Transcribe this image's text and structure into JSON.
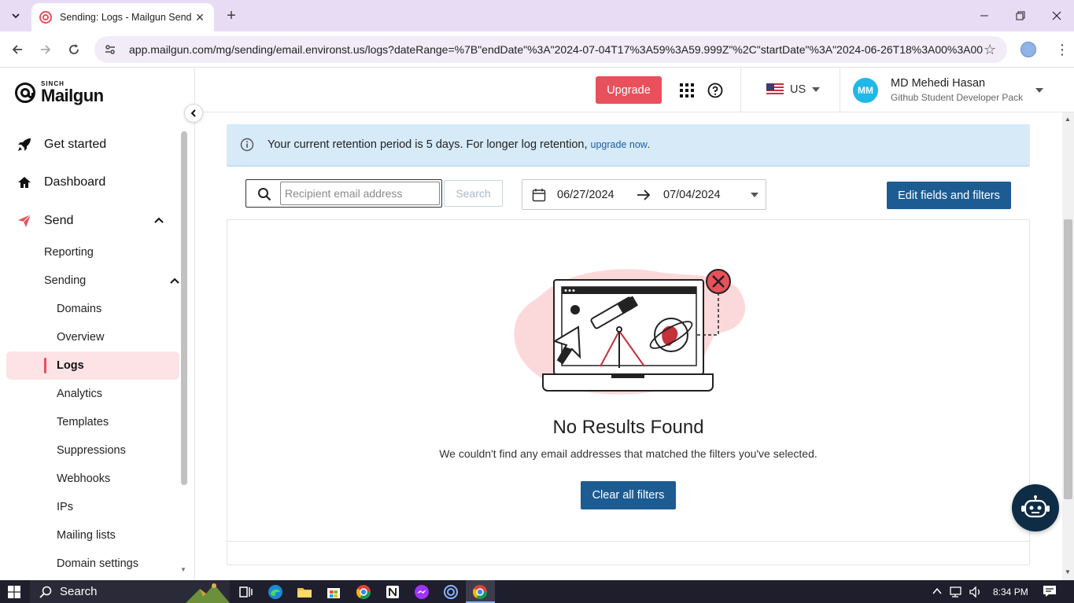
{
  "browser": {
    "tab_title": "Sending: Logs - Mailgun Send",
    "url": "app.mailgun.com/mg/sending/email.environst.us/logs?dateRange=%7B\"endDate\"%3A\"2024-07-04T17%3A59%3A59.999Z\"%2C\"startDate\"%3A\"2024-06-26T18%3A00%3A00...."
  },
  "brand": {
    "sinch": "SINCH",
    "name": "Mailgun",
    "accent": "#e8505b",
    "primary": "#1c5c93"
  },
  "sidebar": {
    "get_started": "Get started",
    "dashboard": "Dashboard",
    "send": "Send",
    "reporting": "Reporting",
    "sending": "Sending",
    "items": [
      "Domains",
      "Overview",
      "Logs",
      "Analytics",
      "Templates",
      "Suppressions",
      "Webhooks",
      "IPs",
      "Mailing lists",
      "Domain settings"
    ],
    "active_item": "Logs"
  },
  "header": {
    "upgrade": "Upgrade",
    "region": "US",
    "avatar_initials": "MM",
    "user_name": "MD Mehedi Hasan",
    "user_plan": "Github Student Developer Pack"
  },
  "banner": {
    "text": "Your current retention period is 5 days. For longer log retention,",
    "link": "upgrade now",
    "end": "."
  },
  "filters": {
    "search_placeholder": "Recipient email address",
    "search_button": "Search",
    "start_date": "06/27/2024",
    "end_date": "07/04/2024",
    "edit_button": "Edit fields and filters"
  },
  "results": {
    "title": "No Results Found",
    "subtitle": "We couldn't find any email addresses that matched the filters you've selected.",
    "clear_button": "Clear all filters"
  },
  "taskbar": {
    "search": "Search",
    "time": "8:34 PM"
  }
}
